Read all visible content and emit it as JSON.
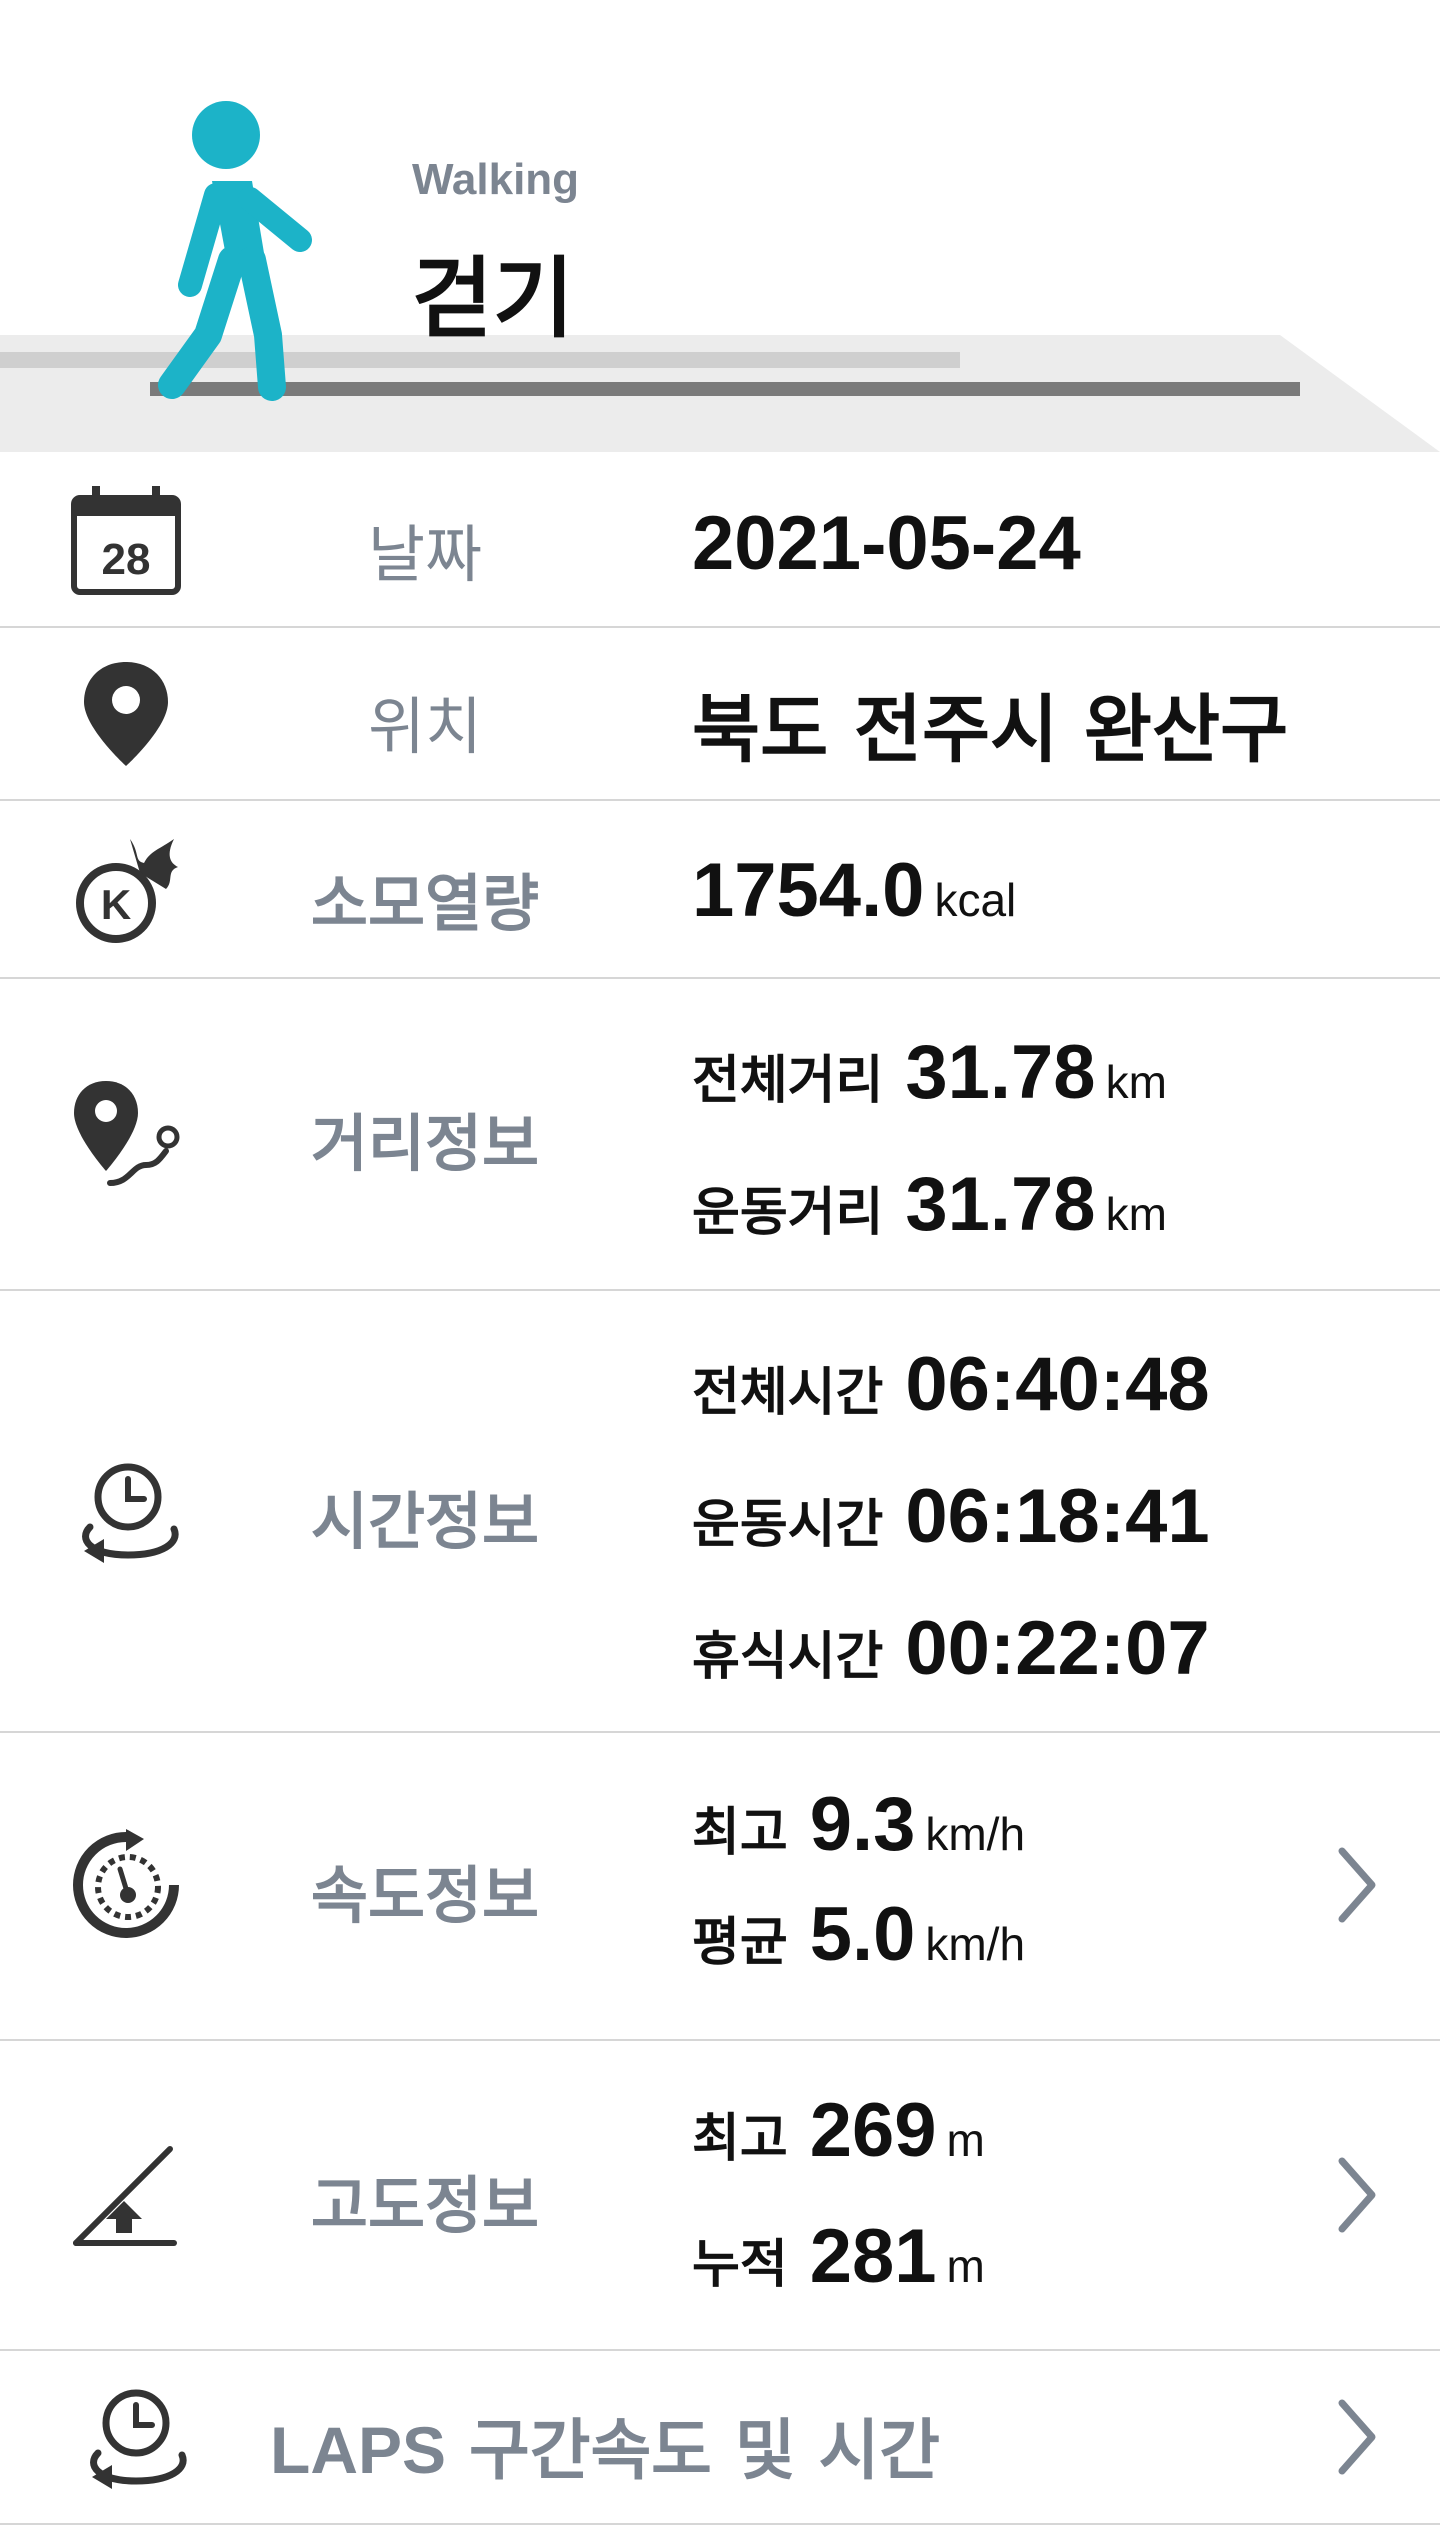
{
  "activity": {
    "name_en": "Walking",
    "name_ko": "걷기"
  },
  "colors": {
    "accent": "#1cb3c8",
    "label": "#7c8591",
    "icon": "#333333",
    "divider": "#d6d6d6"
  },
  "rows": {
    "date": {
      "icon": "calendar-icon",
      "label": "날짜",
      "value": "2021-05-24",
      "calendar_day": "28"
    },
    "location": {
      "icon": "map-pin-icon",
      "label": "위치",
      "value": "북도 전주시 완산구"
    },
    "calories": {
      "icon": "calorie-fire-icon",
      "label": "소모열량",
      "value": "1754.0",
      "unit": "kcal",
      "badge": "K"
    },
    "distance": {
      "icon": "route-pin-icon",
      "label": "거리정보",
      "total_label": "전체거리",
      "total": "31.78",
      "total_unit": "km",
      "exercise_label": "운동거리",
      "exercise": "31.78",
      "exercise_unit": "km"
    },
    "time": {
      "icon": "clock-loop-icon",
      "label": "시간정보",
      "total_label": "전체시간",
      "total": "06:40:48",
      "exercise_label": "운동시간",
      "exercise": "06:18:41",
      "rest_label": "휴식시간",
      "rest": "00:22:07"
    },
    "speed": {
      "icon": "speedometer-icon",
      "label": "속도정보",
      "max_label": "최고",
      "max": "9.3",
      "max_unit": "km/h",
      "avg_label": "평균",
      "avg": "5.0",
      "avg_unit": "km/h"
    },
    "altitude": {
      "icon": "altitude-slope-icon",
      "label": "고도정보",
      "max_label": "최고",
      "max": "269",
      "max_unit": "m",
      "cum_label": "누적",
      "cum": "281",
      "cum_unit": "m"
    },
    "laps": {
      "icon": "clock-loop-icon",
      "label_en": "LAPS",
      "label_ko": "구간속도 및 시간"
    }
  }
}
